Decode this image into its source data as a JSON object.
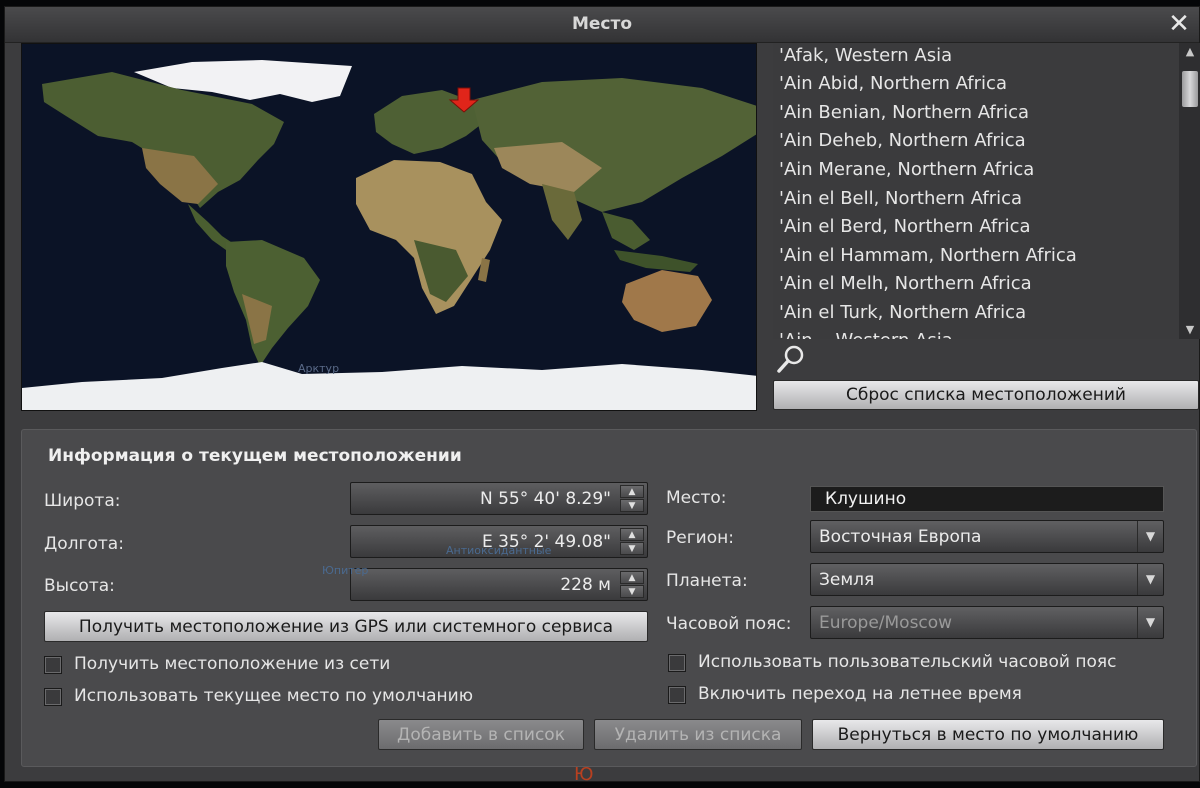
{
  "window": {
    "title": "Место",
    "close_label": "✕"
  },
  "map": {
    "marker_color": "#e0251a",
    "star_label": "Арктур"
  },
  "locations": {
    "items": [
      "'Afak, Western Asia",
      "'Ain Abid, Northern Africa",
      "'Ain Benian, Northern Africa",
      "'Ain Deheb, Northern Africa",
      "'Ain Merane, Northern Africa",
      "'Ain el Bell, Northern Africa",
      "'Ain el Berd, Northern Africa",
      "'Ain el Hammam, Northern Africa",
      "'Ain el Melh, Northern Africa",
      "'Ain el Turk, Northern Africa",
      "'Ain... Western Asia"
    ],
    "search_value": "",
    "reset_label": "Сброс списка местоположений"
  },
  "info": {
    "heading": "Информация о текущем местоположении",
    "latitude_label": "Широта:",
    "latitude_value": "N 55° 40' 8.29\"",
    "longitude_label": "Долгота:",
    "longitude_value": "E 35° 2' 49.08\"",
    "altitude_label": "Высота:",
    "altitude_value": "228 м",
    "gps_button": "Получить местоположение из GPS или системного сервиса",
    "network_checkbox": "Получить местоположение из сети",
    "default_checkbox": "Использовать текущее место по умолчанию",
    "place_label": "Место:",
    "place_value": "Клушино",
    "region_label": "Регион:",
    "region_value": "Восточная Европа",
    "planet_label": "Планета:",
    "planet_value": "Земля",
    "timezone_label": "Часовой пояс:",
    "timezone_value": "Europe/Moscow",
    "custom_tz_checkbox": "Использовать пользовательский часовой пояс",
    "dst_checkbox": "Включить переход на летнее время",
    "add_button": "Добавить в список",
    "remove_button": "Удалить из списка",
    "return_button": "Вернуться в место по умолчанию"
  },
  "background": {
    "star_1": "Юпитер",
    "star_2": "Антиоксидантные",
    "glyph": "Ю"
  }
}
